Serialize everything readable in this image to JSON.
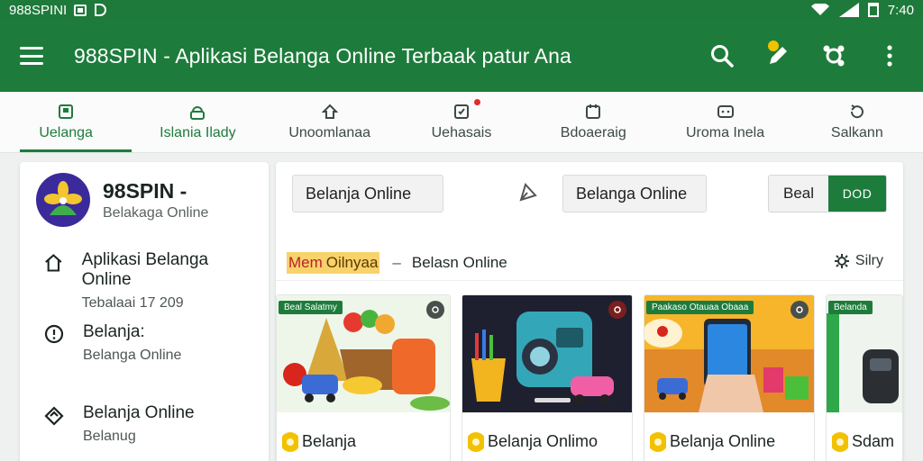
{
  "status_bar": {
    "left_text": "988SPINI",
    "time": "7:40"
  },
  "app_bar": {
    "title": "988SPIN - Aplikasi Belanga Online Terbaak patur Ana"
  },
  "tabs": [
    {
      "label": "Uelanga",
      "icon": "square-icon"
    },
    {
      "label": "Islania Ilady",
      "icon": "lock-icon"
    },
    {
      "label": "Unoomlanaa",
      "icon": "up-icon"
    },
    {
      "label": "Uehasais",
      "icon": "check-icon"
    },
    {
      "label": "Bdoaeraig",
      "icon": "calendar-icon"
    },
    {
      "label": "Uroma Inela",
      "icon": "chat-icon"
    },
    {
      "label": "Salkann",
      "icon": "refresh-icon"
    }
  ],
  "sidebar": {
    "brand_name": "98SPIN -",
    "brand_sub": "Belakaga Online",
    "items": [
      {
        "title": "Aplikasi Belanga Online",
        "sub": "Tebalaai 17 209"
      },
      {
        "title": "Belanja:",
        "sub": "Belanga Online"
      },
      {
        "title": "Belanja Online",
        "sub": "Belanug"
      }
    ]
  },
  "main": {
    "field1": "Belanja Online",
    "field2": "Belanga Online",
    "seg_left": "Beal",
    "seg_right": "DOD",
    "filter_highlight_a": "Mem",
    "filter_highlight_b": "Oilnyaa",
    "filter_dash": "–",
    "filter_text": "Belasn Online",
    "filter_right": "Silry",
    "cards": [
      {
        "tag": "Beal Salatmy",
        "title": "Belanja"
      },
      {
        "tag": "",
        "title": "Belanja Onlimo"
      },
      {
        "tag": "Paakaso Otauaa Obaaa",
        "title": "Belanja Online"
      },
      {
        "tag": "Belanda",
        "title": "Sdam"
      }
    ]
  },
  "colors": {
    "primary": "#1d7c3b",
    "accent_coin": "#f2c200"
  }
}
